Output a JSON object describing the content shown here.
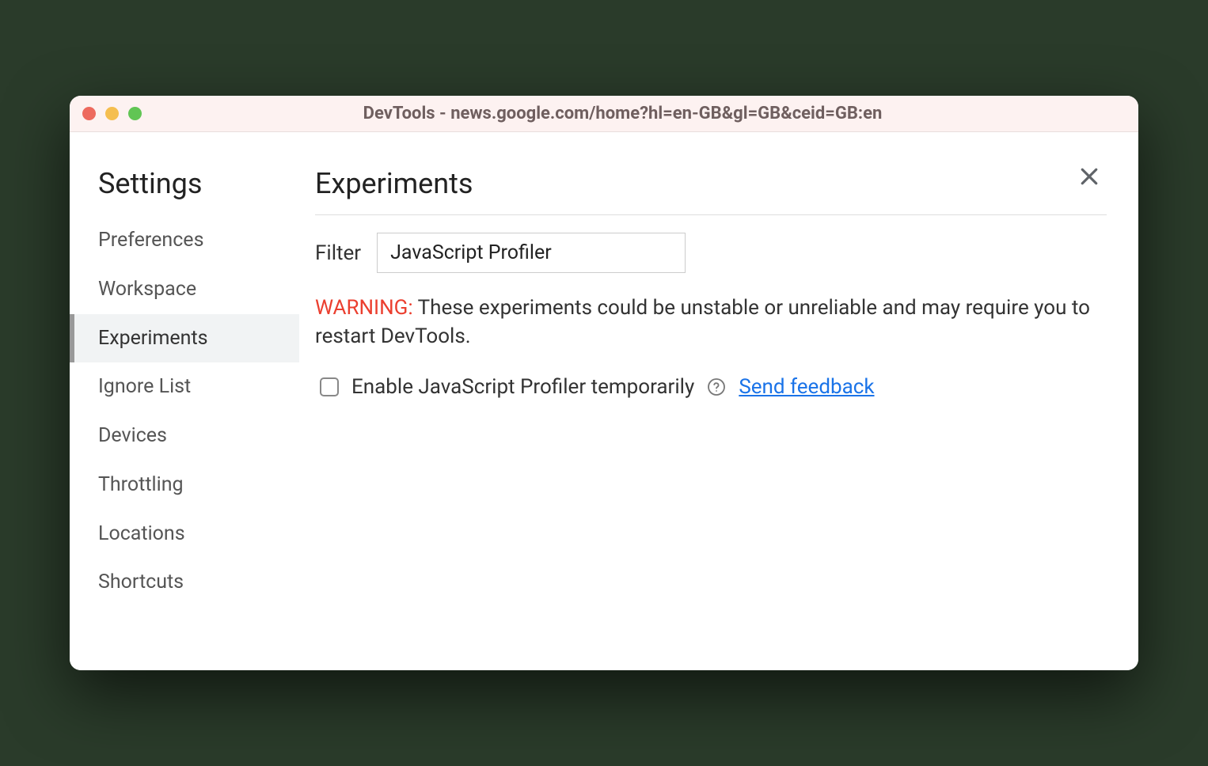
{
  "window": {
    "title": "DevTools - news.google.com/home?hl=en-GB&gl=GB&ceid=GB:en"
  },
  "sidebar": {
    "title": "Settings",
    "items": [
      {
        "label": "Preferences",
        "active": false
      },
      {
        "label": "Workspace",
        "active": false
      },
      {
        "label": "Experiments",
        "active": true
      },
      {
        "label": "Ignore List",
        "active": false
      },
      {
        "label": "Devices",
        "active": false
      },
      {
        "label": "Throttling",
        "active": false
      },
      {
        "label": "Locations",
        "active": false
      },
      {
        "label": "Shortcuts",
        "active": false
      }
    ]
  },
  "content": {
    "title": "Experiments",
    "filter_label": "Filter",
    "filter_value": "JavaScript Profiler",
    "warning_prefix": "WARNING:",
    "warning_text": " These experiments could be unstable or unreliable and may require you to restart DevTools.",
    "experiment_label": "Enable JavaScript Profiler temporarily",
    "feedback_label": "Send feedback"
  }
}
